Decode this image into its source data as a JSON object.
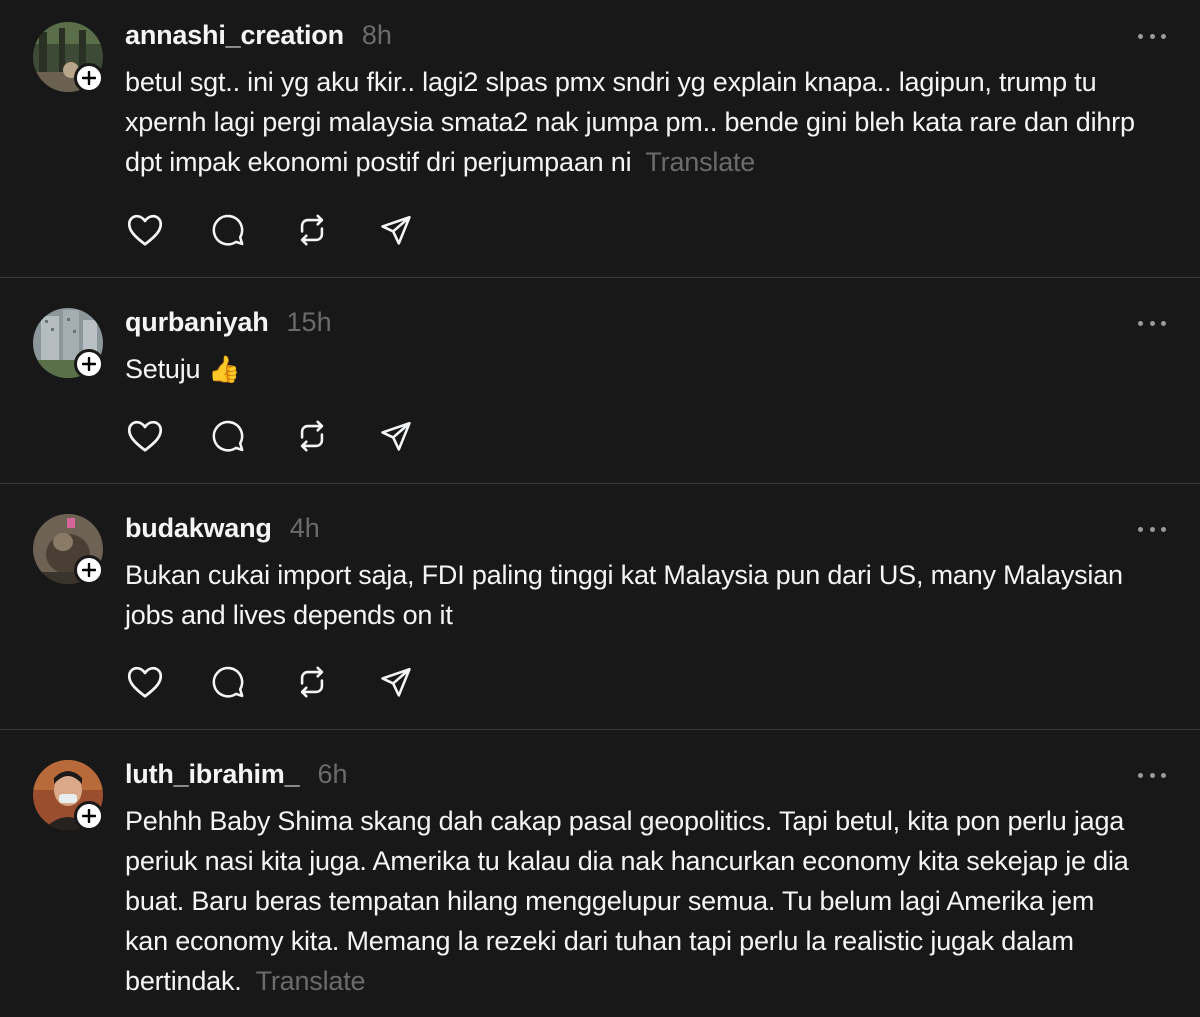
{
  "posts": [
    {
      "username": "annashi_creation",
      "time": "8h",
      "text": "betul sgt.. ini yg aku fkir.. lagi2 slpas pmx sndri yg explain knapa.. lagipun, trump tu xpernh lagi pergi malaysia smata2 nak jumpa pm.. bende gini bleh kata rare dan dihrp dpt impak ekonomi postif dri perjumpaan ni",
      "translate": "Translate",
      "avatar_color": "#4a5a3a"
    },
    {
      "username": "qurbaniyah",
      "time": "15h",
      "text": "Setuju",
      "emoji": "👍",
      "avatar_color": "#6e7a80"
    },
    {
      "username": "budakwang",
      "time": "4h",
      "text": "Bukan cukai import saja, FDI paling tinggi kat Malaysia pun dari US, many Malaysian jobs and lives depends on it",
      "avatar_color": "#5a5044"
    },
    {
      "username": "luth_ibrahim_",
      "time": "6h",
      "text": "Pehhh Baby Shima skang dah cakap pasal geopolitics. Tapi betul, kita pon perlu jaga periuk nasi kita juga. Amerika tu kalau dia nak hancurkan economy kita sekejap je dia buat. Baru beras tempatan hilang menggelupur semua. Tu belum lagi Amerika jem kan economy kita. Memang la rezeki dari tuhan tapi perlu la realistic jugak dalam bertindak.",
      "translate": "Translate",
      "avatar_color": "#8a4a30"
    }
  ],
  "icons": {
    "like": "heart-icon",
    "reply": "comment-icon",
    "repost": "repost-icon",
    "share": "send-icon",
    "more": "more-icon",
    "follow": "plus-icon"
  },
  "colors": {
    "background": "#181818",
    "text": "#f3f5f7",
    "muted": "#6b6b6b",
    "divider": "#3a3a3a"
  }
}
